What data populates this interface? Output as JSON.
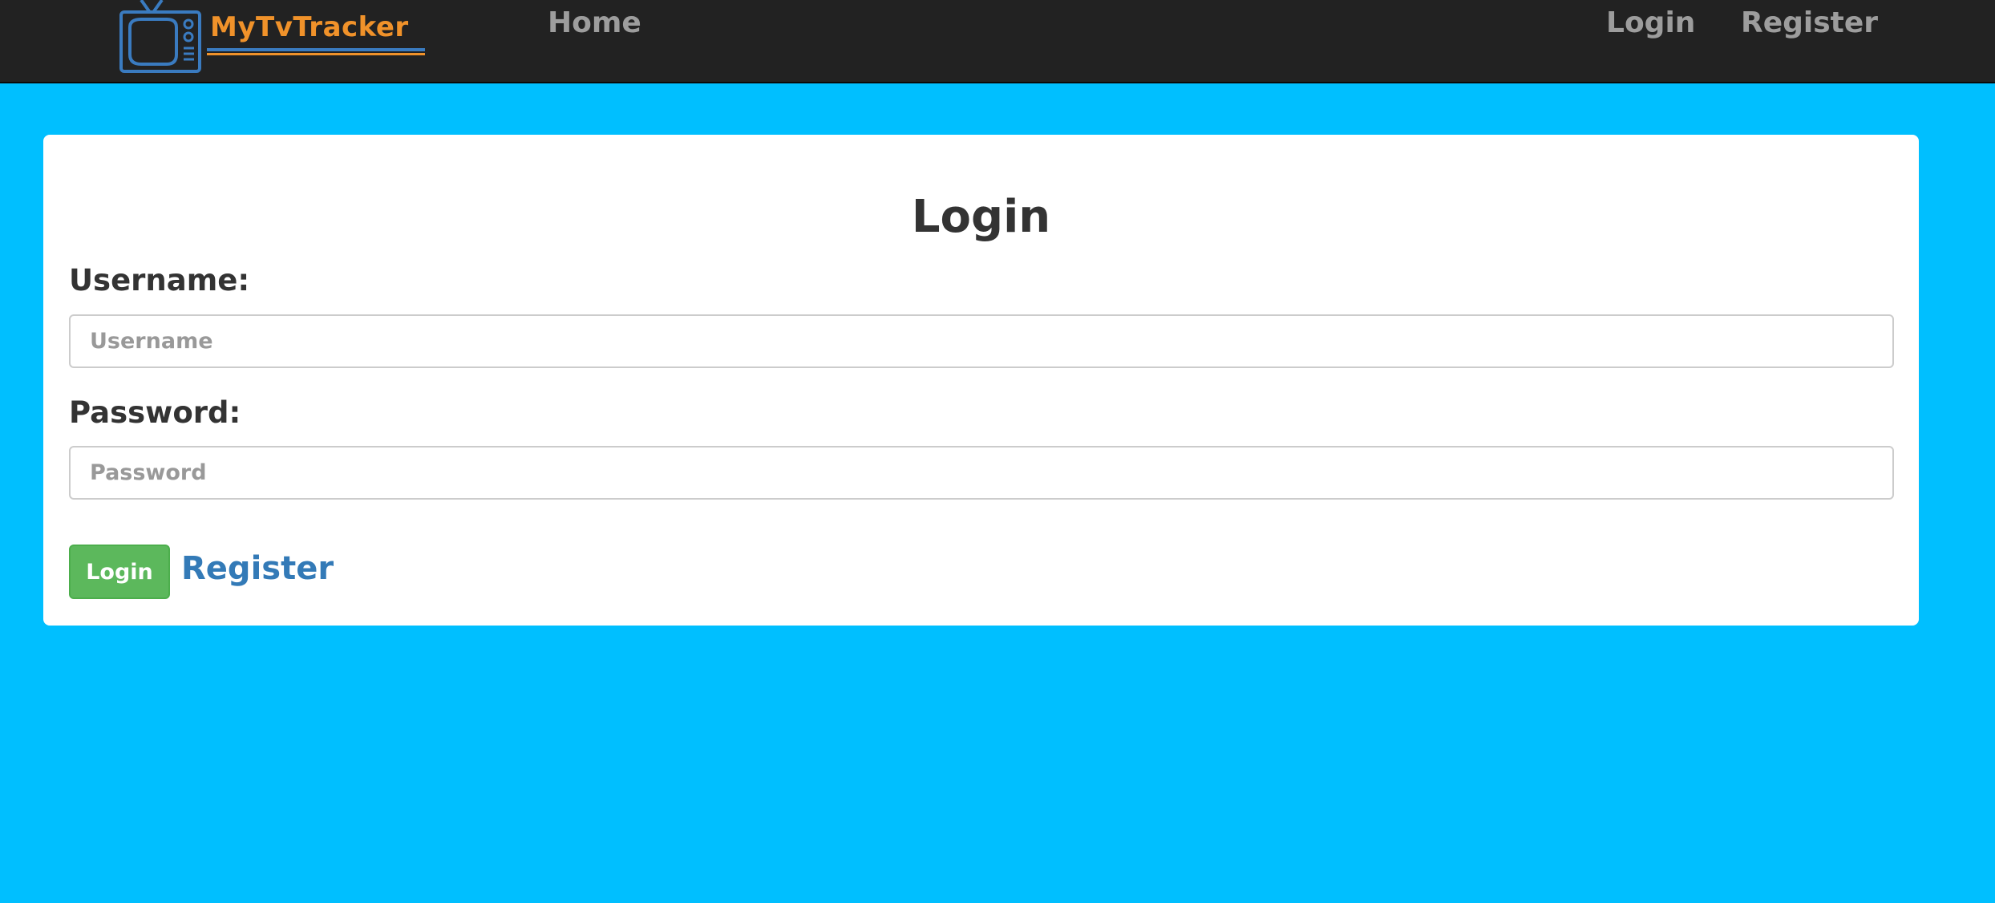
{
  "navbar": {
    "logo": {
      "icon": "tv-icon",
      "text": "MyTvTracker",
      "colors": {
        "icon": "#3a7bc0",
        "text": "#f0922a"
      }
    },
    "links": {
      "home": "Home",
      "login": "Login",
      "register": "Register"
    }
  },
  "form": {
    "title": "Login",
    "username": {
      "label": "Username:",
      "placeholder": "Username",
      "value": ""
    },
    "password": {
      "label": "Password:",
      "placeholder": "Password",
      "value": ""
    },
    "submit_label": "Login",
    "register_link": "Register"
  },
  "colors": {
    "page_background": "#00bfff",
    "navbar_background": "#222222",
    "submit_button": "#5cb85c",
    "link": "#337ab7"
  }
}
